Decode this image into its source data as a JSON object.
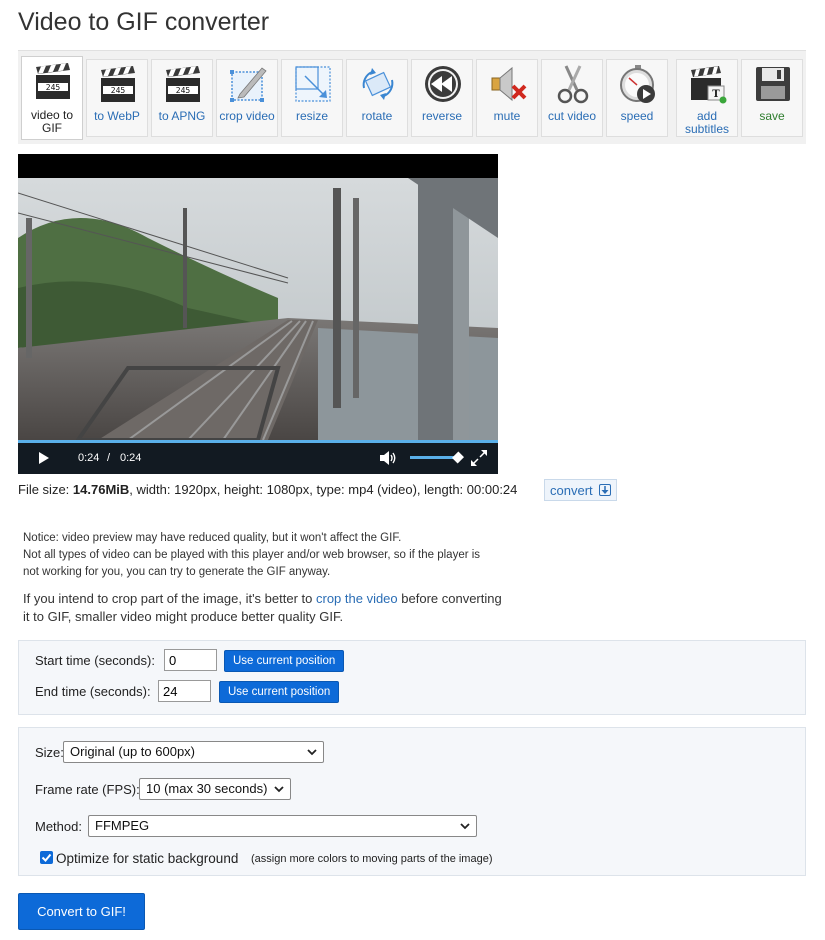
{
  "page": {
    "title": "Video to GIF converter"
  },
  "toolbar": {
    "tools": [
      {
        "label": "video to GIF",
        "icon": "clapperboard-icon"
      },
      {
        "label": "to WebP",
        "icon": "clapperboard-icon"
      },
      {
        "label": "to APNG",
        "icon": "clapperboard-icon"
      },
      {
        "label": "crop video",
        "icon": "crop-icon"
      },
      {
        "label": "resize",
        "icon": "resize-icon"
      },
      {
        "label": "rotate",
        "icon": "rotate-icon"
      },
      {
        "label": "reverse",
        "icon": "rewind-icon"
      },
      {
        "label": "mute",
        "icon": "speaker-muted-icon"
      },
      {
        "label": "cut video",
        "icon": "scissors-icon"
      },
      {
        "label": "speed",
        "icon": "stopwatch-icon"
      },
      {
        "label": "add subtitles",
        "icon": "clapperboard-text-icon"
      },
      {
        "label": "save",
        "icon": "floppy-disk-icon"
      }
    ],
    "clapper_digits": "245"
  },
  "video": {
    "current_time": "0:24",
    "separator": "/",
    "duration": "0:24",
    "progress": 1.0,
    "volume": 0.9
  },
  "file_info": {
    "label": "File size:",
    "size": "14.76MiB",
    "details": ", width: 1920px, height: 1080px, type: mp4 (video), length: 00:00:24",
    "convert_label": "convert"
  },
  "notice": {
    "line1": "Notice: video preview may have reduced quality, but it won't affect the GIF.",
    "line2": "Not all types of video can be played with this player and/or web browser, so if the player is",
    "line3": "not working for you, you can try to generate the GIF anyway."
  },
  "crop_note": {
    "before": "If you intend to crop part of the image, it's better to ",
    "link": "crop the video",
    "after": " before converting",
    "line2": "it to GIF, smaller video might produce better quality GIF."
  },
  "time_panel": {
    "start_label": "Start time (seconds):",
    "start_value": "0",
    "end_label": "End time (seconds):",
    "end_value": "24",
    "use_position_label": "Use current position"
  },
  "options": {
    "size_label": "Size:",
    "size_value": "Original (up to 600px)",
    "fps_label": "Frame rate (FPS):",
    "fps_value": "10 (max 30 seconds)",
    "method_label": "Method:",
    "method_value": "FFMPEG",
    "optimize_label": "Optimize for static background",
    "optimize_hint": "(assign more colors to moving parts of the image)",
    "optimize_checked": true
  },
  "submit": {
    "label": "Convert to GIF!"
  },
  "colors": {
    "accent": "#0d6ad8",
    "link": "#2a6db5",
    "save": "#2e7d2e"
  }
}
